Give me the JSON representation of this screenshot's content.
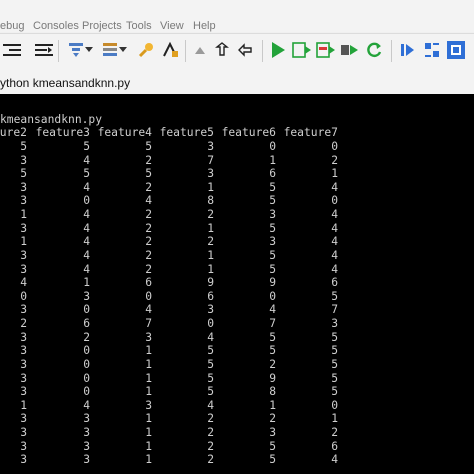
{
  "menu": [
    "ebug",
    "Consoles",
    "Projects",
    "Tools",
    "View",
    "Help"
  ],
  "toolbar": {
    "icons": [
      "indent-icon",
      "unindent-icon",
      "toggle-icon",
      "format-icon",
      "format-dropdown-icon",
      "list-icon",
      "list-dropdown-icon",
      "wrench-icon",
      "function-icon",
      "up-arrow-icon",
      "undo-icon",
      "redo-icon",
      "run-icon",
      "run-in-console-icon",
      "run-selection-icon",
      "step-icon",
      "restart-icon",
      "stop-icon",
      "tab-switch-icon",
      "layout-icon"
    ]
  },
  "tab": {
    "label": "ython  kmeansandknn.py"
  },
  "console": {
    "command": "kmeansandknn.py",
    "headers": [
      "ure2",
      "feature3",
      "feature4",
      "feature5",
      "feature6",
      "feature7"
    ],
    "rows": [
      [
        "5",
        "5",
        "5",
        "3",
        "0",
        "0"
      ],
      [
        "3",
        "4",
        "2",
        "7",
        "1",
        "2"
      ],
      [
        "5",
        "5",
        "5",
        "3",
        "6",
        "1"
      ],
      [
        "3",
        "4",
        "2",
        "1",
        "5",
        "4"
      ],
      [
        "3",
        "0",
        "4",
        "8",
        "5",
        "0"
      ],
      [
        "1",
        "4",
        "2",
        "2",
        "3",
        "4"
      ],
      [
        "3",
        "4",
        "2",
        "1",
        "5",
        "4"
      ],
      [
        "1",
        "4",
        "2",
        "2",
        "3",
        "4"
      ],
      [
        "3",
        "4",
        "2",
        "1",
        "5",
        "4"
      ],
      [
        "3",
        "4",
        "2",
        "1",
        "5",
        "4"
      ],
      [
        "4",
        "1",
        "6",
        "9",
        "9",
        "6"
      ],
      [
        "0",
        "3",
        "0",
        "6",
        "0",
        "5"
      ],
      [
        "3",
        "0",
        "4",
        "3",
        "4",
        "7"
      ],
      [
        "2",
        "6",
        "7",
        "0",
        "7",
        "3"
      ],
      [
        "3",
        "2",
        "3",
        "4",
        "5",
        "5"
      ],
      [
        "3",
        "0",
        "1",
        "5",
        "5",
        "5"
      ],
      [
        "3",
        "0",
        "1",
        "5",
        "2",
        "5"
      ],
      [
        "3",
        "0",
        "1",
        "5",
        "9",
        "5"
      ],
      [
        "3",
        "0",
        "1",
        "5",
        "8",
        "5"
      ],
      [
        "1",
        "4",
        "3",
        "4",
        "1",
        "0"
      ],
      [
        "3",
        "3",
        "1",
        "2",
        "2",
        "1"
      ],
      [
        "3",
        "3",
        "1",
        "2",
        "3",
        "2"
      ],
      [
        "3",
        "3",
        "1",
        "2",
        "5",
        "6"
      ],
      [
        "3",
        "3",
        "1",
        "2",
        "5",
        "4"
      ]
    ]
  },
  "colors": {
    "console_bg": "#000000",
    "console_text": "#cfcfcf",
    "run_green": "#23a33a",
    "accent_blue": "#2f6fd6"
  }
}
